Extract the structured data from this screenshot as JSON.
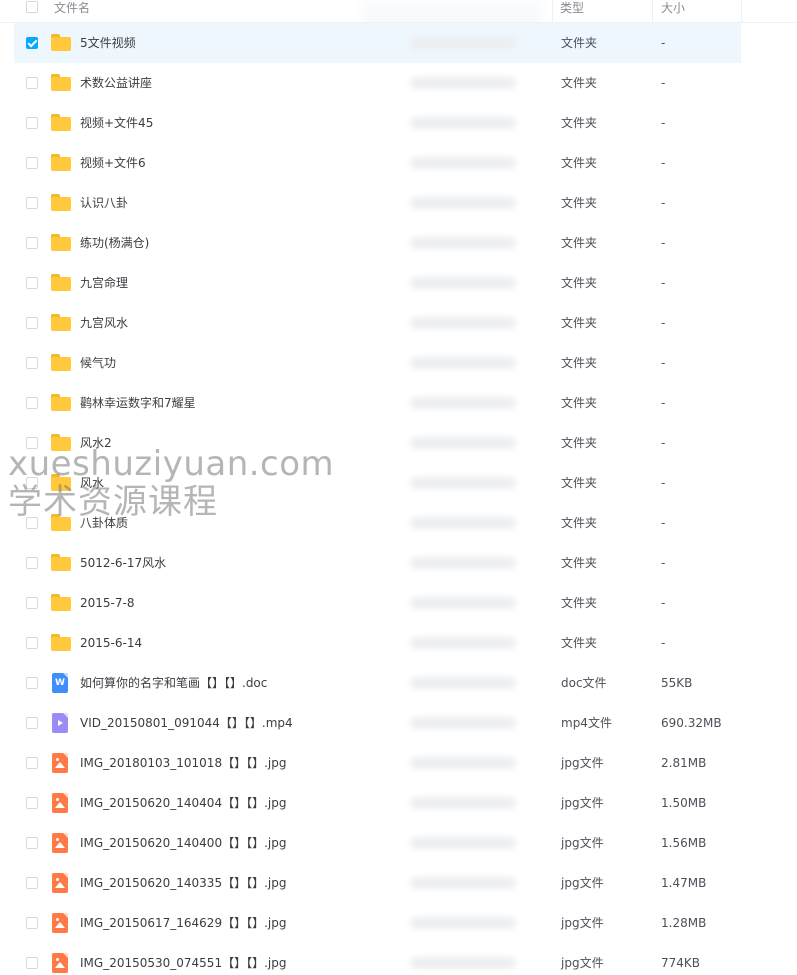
{
  "header": {
    "name_label": "文件名",
    "type_label": "类型",
    "size_label": "大小"
  },
  "watermark": {
    "line1": "xueshuziyuan.com",
    "line2": "学术资源课程"
  },
  "files": [
    {
      "name": "5文件视频",
      "type": "文件夹",
      "size": "-",
      "kind": "folder",
      "checked": true
    },
    {
      "name": "术数公益讲座",
      "type": "文件夹",
      "size": "-",
      "kind": "folder"
    },
    {
      "name": "视频+文件45",
      "type": "文件夹",
      "size": "-",
      "kind": "folder"
    },
    {
      "name": "视频+文件6",
      "type": "文件夹",
      "size": "-",
      "kind": "folder"
    },
    {
      "name": "认识八卦",
      "type": "文件夹",
      "size": "-",
      "kind": "folder"
    },
    {
      "name": "练功(杨满仓)",
      "type": "文件夹",
      "size": "-",
      "kind": "folder"
    },
    {
      "name": "九宫命理",
      "type": "文件夹",
      "size": "-",
      "kind": "folder"
    },
    {
      "name": "九宫风水",
      "type": "文件夹",
      "size": "-",
      "kind": "folder"
    },
    {
      "name": "候气功",
      "type": "文件夹",
      "size": "-",
      "kind": "folder"
    },
    {
      "name": "鹳林幸运数字和7耀星",
      "type": "文件夹",
      "size": "-",
      "kind": "folder"
    },
    {
      "name": "风水2",
      "type": "文件夹",
      "size": "-",
      "kind": "folder"
    },
    {
      "name": "风水",
      "type": "文件夹",
      "size": "-",
      "kind": "folder"
    },
    {
      "name": "八卦体质",
      "type": "文件夹",
      "size": "-",
      "kind": "folder"
    },
    {
      "name": "5012-6-17风水",
      "type": "文件夹",
      "size": "-",
      "kind": "folder"
    },
    {
      "name": "2015-7-8",
      "type": "文件夹",
      "size": "-",
      "kind": "folder"
    },
    {
      "name": "2015-6-14",
      "type": "文件夹",
      "size": "-",
      "kind": "folder"
    },
    {
      "name": "如何算你的名字和笔画【】【】.doc",
      "type": "doc文件",
      "size": "55KB",
      "kind": "word"
    },
    {
      "name": "VID_20150801_091044【】【】.mp4",
      "type": "mp4文件",
      "size": "690.32MB",
      "kind": "video"
    },
    {
      "name": "IMG_20180103_101018【】【】.jpg",
      "type": "jpg文件",
      "size": "2.81MB",
      "kind": "image"
    },
    {
      "name": "IMG_20150620_140404【】【】.jpg",
      "type": "jpg文件",
      "size": "1.50MB",
      "kind": "image"
    },
    {
      "name": "IMG_20150620_140400【】【】.jpg",
      "type": "jpg文件",
      "size": "1.56MB",
      "kind": "image"
    },
    {
      "name": "IMG_20150620_140335【】【】.jpg",
      "type": "jpg文件",
      "size": "1.47MB",
      "kind": "image"
    },
    {
      "name": "IMG_20150617_164629【】【】.jpg",
      "type": "jpg文件",
      "size": "1.28MB",
      "kind": "image"
    },
    {
      "name": "IMG_20150530_074551【】【】.jpg",
      "type": "jpg文件",
      "size": "774KB",
      "kind": "image"
    }
  ],
  "colors": {
    "accent": "#06a7ff",
    "folder": "#ffc93b",
    "selected_row": "#eef7fe",
    "word_icon": "#3f8efc",
    "video_icon": "#9a8cf6",
    "image_icon": "#ff7a45"
  }
}
